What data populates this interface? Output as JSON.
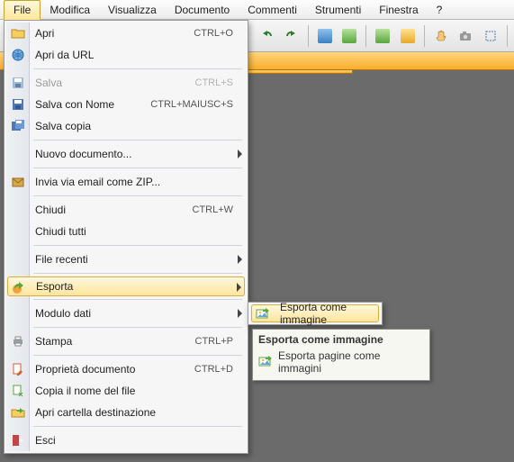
{
  "menubar": {
    "items": [
      "File",
      "Modifica",
      "Visualizza",
      "Documento",
      "Commenti",
      "Strumenti",
      "Finestra",
      "?"
    ],
    "active_index": 0
  },
  "file_menu": {
    "open": {
      "label": "Apri",
      "accel": "CTRL+O"
    },
    "open_url": {
      "label": "Apri da URL"
    },
    "save": {
      "label": "Salva",
      "accel": "CTRL+S"
    },
    "save_as": {
      "label": "Salva con Nome",
      "accel": "CTRL+MAIUSC+S"
    },
    "save_copy": {
      "label": "Salva copia"
    },
    "new_doc": {
      "label": "Nuovo documento..."
    },
    "email_zip": {
      "label": "Invia via email come ZIP..."
    },
    "close": {
      "label": "Chiudi",
      "accel": "CTRL+W"
    },
    "close_all": {
      "label": "Chiudi tutti"
    },
    "recent": {
      "label": "File recenti"
    },
    "export": {
      "label": "Esporta"
    },
    "data_module": {
      "label": "Modulo dati"
    },
    "print": {
      "label": "Stampa",
      "accel": "CTRL+P"
    },
    "doc_props": {
      "label": "Proprietà documento",
      "accel": "CTRL+D"
    },
    "copy_filename": {
      "label": "Copia il nome del file"
    },
    "open_folder": {
      "label": "Apri cartella destinazione"
    },
    "exit": {
      "label": "Esci"
    }
  },
  "export_submenu": {
    "export_image": {
      "label": "Esporta come immagine"
    }
  },
  "tooltip": {
    "title": "Esporta come immagine",
    "body": "Esporta pagine come immagini"
  }
}
